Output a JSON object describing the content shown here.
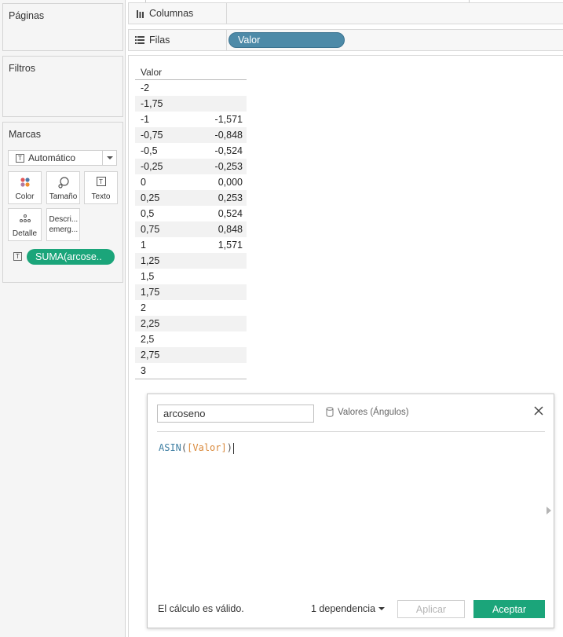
{
  "left_panel": {
    "pages_title": "Páginas",
    "filters_title": "Filtros",
    "marks": {
      "title": "Marcas",
      "type_value": "Automático",
      "buttons": [
        {
          "label": "Color",
          "icon": "color-dots-icon"
        },
        {
          "label": "Tamaño",
          "icon": "size-icon"
        },
        {
          "label": "Texto",
          "icon": "text-icon"
        },
        {
          "label": "Detalle",
          "icon": "detail-dots-icon"
        },
        {
          "label": "Descri... emerg...",
          "icon": "tooltip-icon"
        }
      ],
      "text_pill": "SUMA(arcose.."
    }
  },
  "shelves": {
    "columns_label": "Columnas",
    "rows_label": "Filas",
    "rows_pill": "Valor"
  },
  "table": {
    "header": "Valor",
    "rows": [
      {
        "valor": "-2",
        "arcoseno": ""
      },
      {
        "valor": "-1,75",
        "arcoseno": ""
      },
      {
        "valor": "-1",
        "arcoseno": "-1,571"
      },
      {
        "valor": "-0,75",
        "arcoseno": "-0,848"
      },
      {
        "valor": "-0,5",
        "arcoseno": "-0,524"
      },
      {
        "valor": "-0,25",
        "arcoseno": "-0,253"
      },
      {
        "valor": "0",
        "arcoseno": "0,000"
      },
      {
        "valor": "0,25",
        "arcoseno": "0,253"
      },
      {
        "valor": "0,5",
        "arcoseno": "0,524"
      },
      {
        "valor": "0,75",
        "arcoseno": "0,848"
      },
      {
        "valor": "1",
        "arcoseno": "1,571"
      },
      {
        "valor": "1,25",
        "arcoseno": ""
      },
      {
        "valor": "1,5",
        "arcoseno": ""
      },
      {
        "valor": "1,75",
        "arcoseno": ""
      },
      {
        "valor": "2",
        "arcoseno": ""
      },
      {
        "valor": "2,25",
        "arcoseno": ""
      },
      {
        "valor": "2,5",
        "arcoseno": ""
      },
      {
        "valor": "2,75",
        "arcoseno": ""
      },
      {
        "valor": "3",
        "arcoseno": ""
      }
    ]
  },
  "calc_dialog": {
    "name": "arcoseno",
    "datasource": "Valores (Ángulos)",
    "formula_fn": "ASIN",
    "formula_open": "(",
    "formula_field": "[Valor]",
    "formula_close": ")",
    "status": "El cálculo es válido.",
    "dependencies": "1 dependencia",
    "apply_label": "Aplicar",
    "ok_label": "Aceptar"
  },
  "colors": {
    "pill_blue": "#4d8aa8",
    "pill_green": "#1ba57a",
    "accent_ok": "#1ba57a",
    "formula_function": "#3f7fa3",
    "formula_field": "#d9893b"
  }
}
